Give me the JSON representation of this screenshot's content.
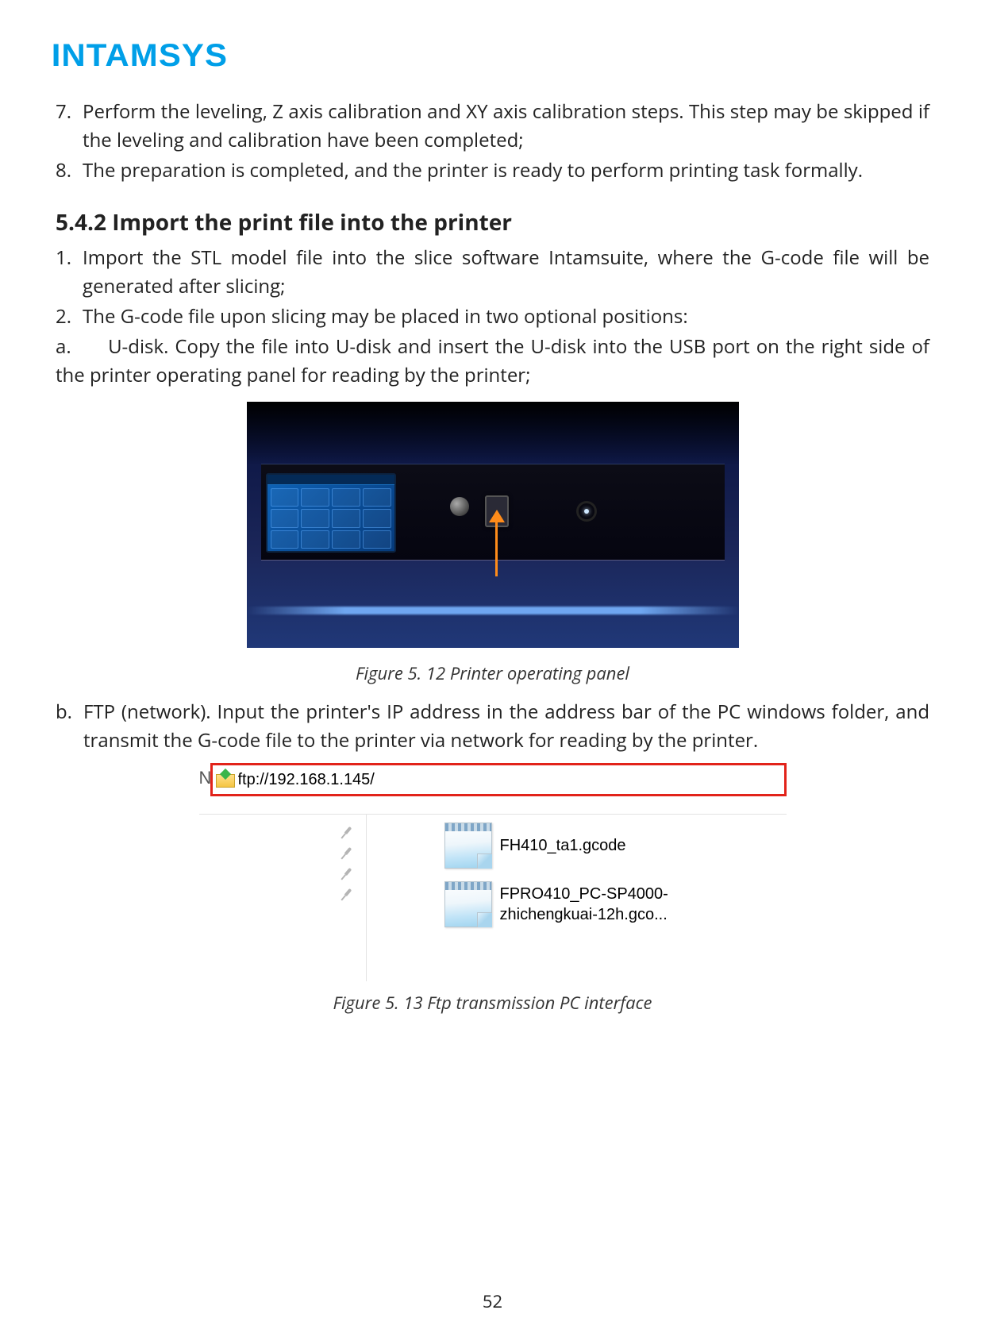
{
  "brand_logo_text": "INTAMSYS",
  "steps_top": [
    {
      "num": "7.",
      "text": "Perform the leveling, Z axis calibration and XY axis calibration steps. This step may be skipped if the leveling and calibration have been completed;"
    },
    {
      "num": "8.",
      "text": "The preparation is completed, and the printer is ready to perform printing task formally."
    }
  ],
  "section_heading": "5.4.2 Import the print file into the printer",
  "steps_import": [
    {
      "num": "1.",
      "text": "Import the STL model file into the slice software Intamsuite, where the G-code file will be generated after slicing;"
    },
    {
      "num": "2.",
      "text": "The G-code file upon slicing may be placed in two optional positions:"
    }
  ],
  "sub_a_prefix": "a.",
  "sub_a_text": "U-disk. Copy the file into U-disk and insert the U-disk into the USB port on the right side of the printer operating panel for reading by the printer;",
  "figure_512_caption": "Figure 5. 12 Printer operating panel",
  "sub_b_prefix": "b.",
  "sub_b_text": "FTP (network). Input the printer's IP address in the address bar of the PC windows folder, and transmit the G-code file to the printer via network for reading by the printer.",
  "ftp_stray_char": "N",
  "ftp_address": "ftp://192.168.1.145/",
  "ftp_files": [
    "FH410_ta1.gcode",
    "FPRO410_PC-SP4000-zhichengkuai-12h.gco..."
  ],
  "nav_pin_rows": 4,
  "figure_513_caption": "Figure 5. 13 Ftp transmission PC interface",
  "page_number": "52"
}
